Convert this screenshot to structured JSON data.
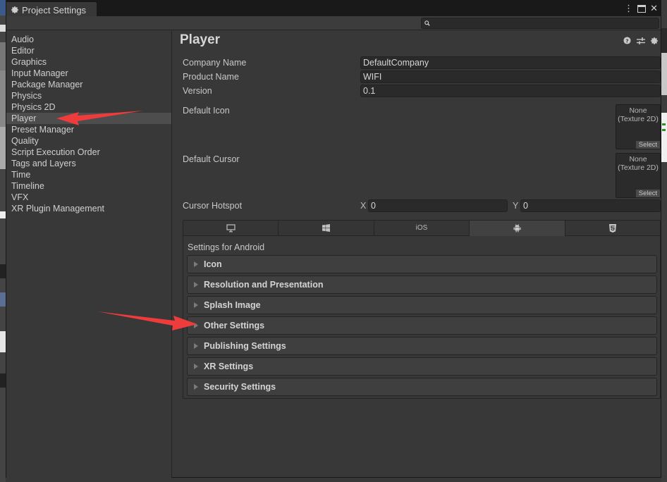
{
  "window": {
    "tab_title": "Project Settings",
    "controls": {
      "more": "⋮",
      "maximize": "🗖",
      "close": "✕"
    },
    "search": {
      "placeholder": "",
      "value": ""
    }
  },
  "sidebar": {
    "items": [
      {
        "label": "Audio",
        "active": false
      },
      {
        "label": "Editor",
        "active": false
      },
      {
        "label": "Graphics",
        "active": false
      },
      {
        "label": "Input Manager",
        "active": false
      },
      {
        "label": "Package Manager",
        "active": false
      },
      {
        "label": "Physics",
        "active": false
      },
      {
        "label": "Physics 2D",
        "active": false
      },
      {
        "label": "Player",
        "active": true
      },
      {
        "label": "Preset Manager",
        "active": false
      },
      {
        "label": "Quality",
        "active": false
      },
      {
        "label": "Script Execution Order",
        "active": false
      },
      {
        "label": "Tags and Layers",
        "active": false
      },
      {
        "label": "Time",
        "active": false
      },
      {
        "label": "Timeline",
        "active": false
      },
      {
        "label": "VFX",
        "active": false
      },
      {
        "label": "XR Plugin Management",
        "active": false
      }
    ]
  },
  "main": {
    "title": "Player",
    "title_icons": [
      "help-icon",
      "presets-icon",
      "settings-gear-icon"
    ],
    "fields": {
      "company_name": {
        "label": "Company Name",
        "value": "DefaultCompany"
      },
      "product_name": {
        "label": "Product Name",
        "value": "WIFI"
      },
      "version": {
        "label": "Version",
        "value": "0.1"
      }
    },
    "default_icon": {
      "label": "Default Icon",
      "value_line1": "None",
      "value_line2": "(Texture 2D)",
      "select": "Select"
    },
    "default_cursor": {
      "label": "Default Cursor",
      "value_line1": "None",
      "value_line2": "(Texture 2D)",
      "select": "Select"
    },
    "cursor_hotspot": {
      "label": "Cursor Hotspot",
      "x_label": "X",
      "x_value": "0",
      "y_label": "Y",
      "y_value": "0"
    },
    "platform_tabs": [
      {
        "name": "standalone",
        "icon": "monitor-icon",
        "label": ""
      },
      {
        "name": "windows",
        "icon": "windows-icon",
        "label": ""
      },
      {
        "name": "ios",
        "icon": "",
        "label": "iOS"
      },
      {
        "name": "android",
        "icon": "android-icon",
        "label": "",
        "active": true
      },
      {
        "name": "webgl",
        "icon": "html5-icon",
        "label": ""
      }
    ],
    "settings_for": "Settings for Android",
    "sections": [
      "Icon",
      "Resolution and Presentation",
      "Splash Image",
      "Other Settings",
      "Publishing Settings",
      "XR Settings",
      "Security Settings"
    ]
  },
  "annotations": {
    "arrow_color": "#ee3b3b"
  }
}
